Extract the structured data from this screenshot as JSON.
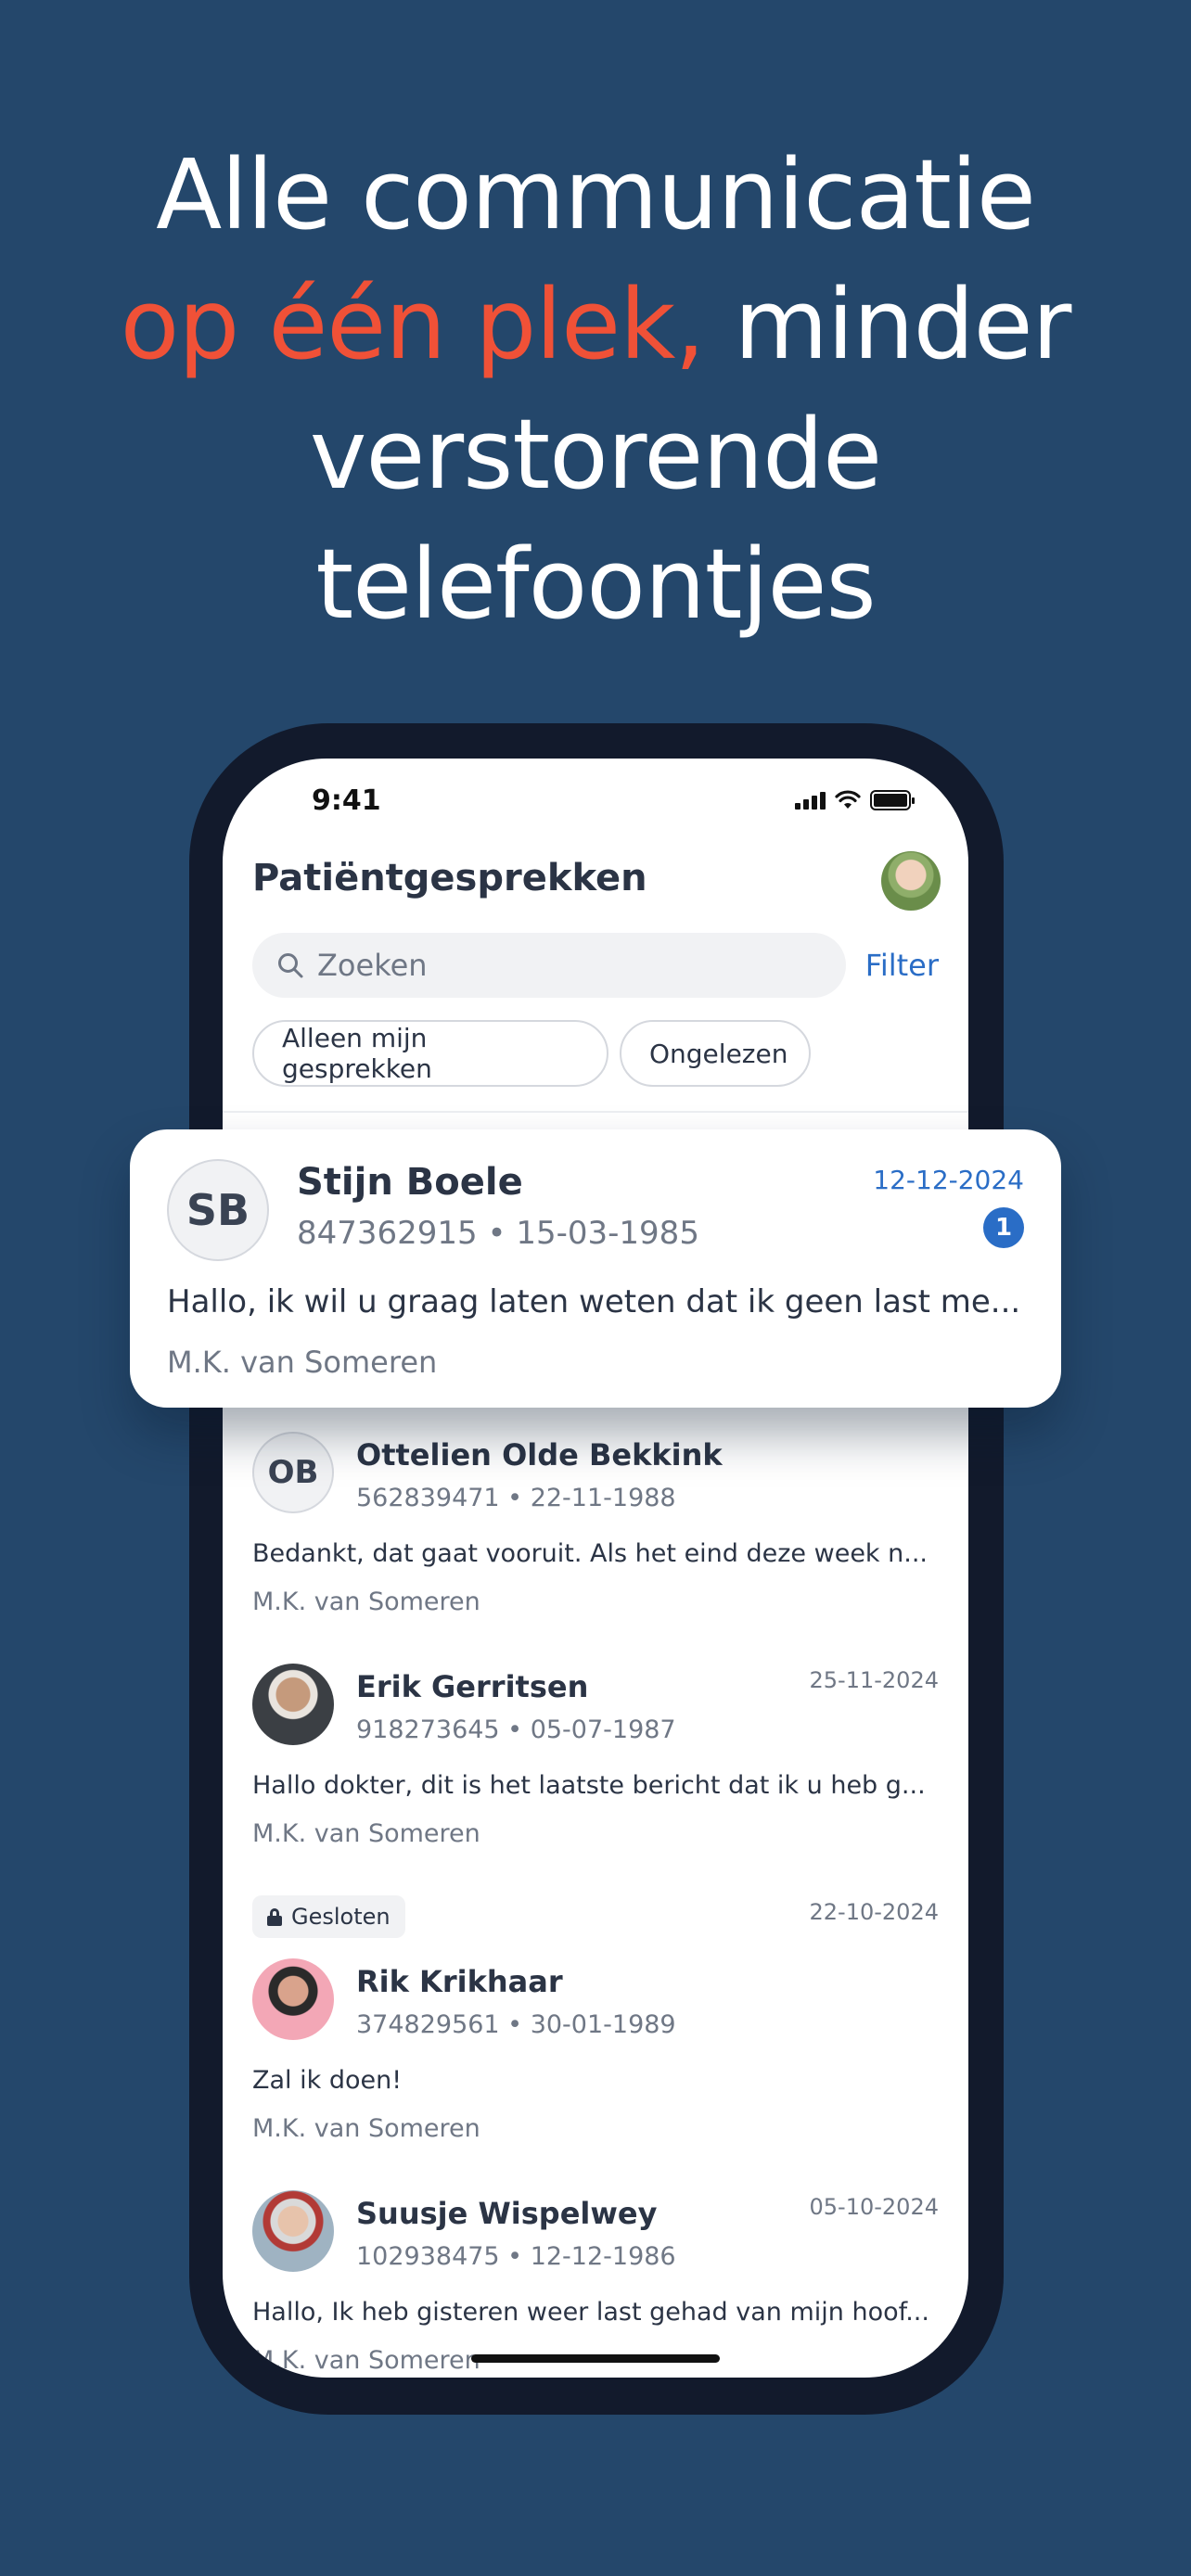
{
  "headline": {
    "line1": "Alle communicatie",
    "line2_accent": "op één plek,",
    "line2_rest": " minder",
    "line3": "verstorende",
    "line4": "telefoontjes"
  },
  "colors": {
    "background": "#24476b",
    "accent": "#f05137",
    "link": "#2a6dc6"
  },
  "status_bar": {
    "time": "9:41"
  },
  "app": {
    "title": "Patiëntgesprekken",
    "search_placeholder": "Zoeken",
    "filter_label": "Filter",
    "chips": [
      "Alleen mijn gesprekken",
      "Ongelezen"
    ]
  },
  "featured": {
    "initials": "SB",
    "name": "Stijn Boele",
    "meta": "847362915 • 15-03-1985",
    "date": "12-12-2024",
    "unread": "1",
    "message": "Hallo, ik wil u graag laten weten dat ik geen last me...",
    "author": "M.K. van Someren"
  },
  "conversations": [
    {
      "initials": "OB",
      "name": "Ottelien Olde Bekkink",
      "meta": "562839471 • 22-11-1988",
      "date": "",
      "message": "Bedankt, dat gaat vooruit. Als het eind deze week n...",
      "author": "M.K. van Someren"
    },
    {
      "name": "Erik Gerritsen",
      "meta": "918273645 • 05-07-1987",
      "date": "25-11-2024",
      "message": "Hallo dokter, dit is het laatste bericht dat ik u heb g...",
      "author": "M.K. van Someren"
    },
    {
      "badge": "Gesloten",
      "name": "Rik Krikhaar",
      "meta": "374829561 • 30-01-1989",
      "date": "22-10-2024",
      "message": "Zal ik doen!",
      "author": "M.K. van Someren"
    },
    {
      "name": "Suusje Wispelwey",
      "meta": "102938475 • 12-12-1986",
      "date": "05-10-2024",
      "message": "Hallo, Ik heb gisteren weer last gehad van mijn hoof...",
      "author": "M.K. van Someren"
    }
  ]
}
